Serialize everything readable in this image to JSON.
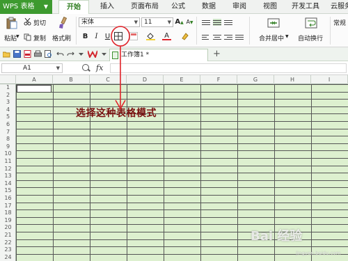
{
  "app": {
    "name": "WPS 表格",
    "caret": "▼"
  },
  "menu": {
    "tabs": [
      "开始",
      "插入",
      "页面布局",
      "公式",
      "数据",
      "审阅",
      "视图",
      "开发工具",
      "云服务"
    ],
    "active": "开始"
  },
  "ribbon": {
    "paste": "粘贴",
    "paste_dd": "▼",
    "cut": "剪切",
    "copy": "复制",
    "format_painter": "格式刷",
    "font_name": "宋体",
    "font_size": "11",
    "grow_font": "A",
    "shrink_font": "A",
    "bold": "B",
    "italic": "I",
    "underline": "U",
    "font_color_label": "A",
    "merge_center": "合并居中",
    "wrap_text": "自动换行",
    "number_format": "常规",
    "dropdown_glyph": "▼"
  },
  "quickbar": {
    "doc_tab": "工作簿1 *",
    "add_tab": "+"
  },
  "formula_bar": {
    "name_box": "A1",
    "fx": "fx",
    "name_dd": "▼"
  },
  "sheet": {
    "columns": [
      "A",
      "B",
      "C",
      "D",
      "E",
      "F",
      "G",
      "H",
      "I"
    ],
    "rows": [
      "1",
      "2",
      "3",
      "4",
      "5",
      "6",
      "7",
      "8",
      "9",
      "10",
      "11",
      "12",
      "13",
      "14",
      "15",
      "16",
      "17",
      "18",
      "19",
      "20",
      "21",
      "22",
      "23",
      "24"
    ]
  },
  "annotation": "选择这种表格模式",
  "watermark": {
    "text": "Bai 经验",
    "sub": "jingyan.baidu.com"
  },
  "colors": {
    "brand_green": "#3d9a2f",
    "sheet_fill": "#ddf0cf",
    "annotation_red": "#e0232a",
    "annotation_text": "#7a1010"
  }
}
